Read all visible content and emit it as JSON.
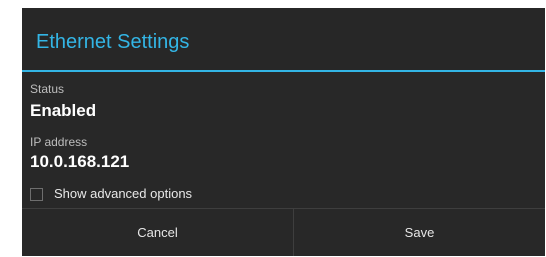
{
  "dialog": {
    "title": "Ethernet Settings",
    "accent_color": "#33b5e5",
    "background_color": "#282828"
  },
  "fields": {
    "status": {
      "label": "Status",
      "value": "Enabled"
    },
    "ip_address": {
      "label": "IP address",
      "value": "10.0.168.121"
    }
  },
  "advanced_option": {
    "label": "Show advanced options",
    "checked": false
  },
  "buttons": {
    "cancel_label": "Cancel",
    "save_label": "Save"
  }
}
